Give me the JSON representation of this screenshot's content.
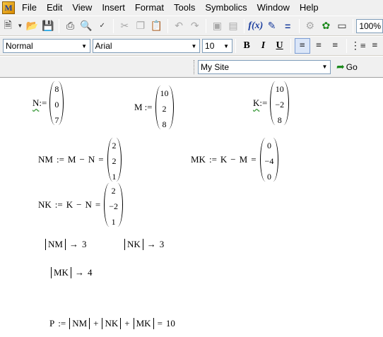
{
  "menubar": {
    "app_icon_label": "M",
    "items": [
      "File",
      "Edit",
      "View",
      "Insert",
      "Format",
      "Tools",
      "Symbolics",
      "Window",
      "Help"
    ]
  },
  "toolbar_standard": {
    "zoom": "100%",
    "icons": [
      "new-icon",
      "open-icon",
      "save-icon",
      "print-icon",
      "print-preview-icon",
      "spell-check-icon",
      "cut-icon",
      "copy-icon",
      "paste-icon",
      "undo-icon",
      "redo-icon",
      "align-across-icon",
      "align-down-icon",
      "insert-function-icon",
      "insert-unit-icon",
      "calculate-icon",
      "component-icon",
      "resource-icon",
      "zoom-icon"
    ]
  },
  "toolbar_format": {
    "style": "Normal",
    "font": "Arial",
    "size": "10",
    "bold": "B",
    "italic": "I",
    "underline": "U"
  },
  "toolbar_resources": {
    "site": "My Site",
    "go_label": "Go"
  },
  "worksheet": {
    "N": {
      "name": "N",
      "assign": ":=",
      "values": [
        "8",
        "0",
        "7"
      ]
    },
    "M": {
      "name": "M",
      "assign": ":=",
      "values": [
        "10",
        "2",
        "8"
      ]
    },
    "K": {
      "name": "K",
      "assign": ":=",
      "values": [
        "10",
        "−2",
        "8"
      ]
    },
    "NM": {
      "lhs": "NM",
      "assign": ":=",
      "a": "M",
      "minus": "−",
      "b": "N",
      "eq": "=",
      "values": [
        "2",
        "2",
        "1"
      ]
    },
    "MK": {
      "lhs": "MK",
      "assign": ":=",
      "a": "K",
      "minus": "−",
      "b": "M",
      "eq": "=",
      "values": [
        "0",
        "−4",
        "0"
      ]
    },
    "NK": {
      "lhs": "NK",
      "assign": ":=",
      "a": "K",
      "minus": "−",
      "b": "N",
      "eq": "=",
      "values": [
        "2",
        "−2",
        "1"
      ]
    },
    "abs_NM": {
      "name": "NM",
      "arrow": "→",
      "result": "3"
    },
    "abs_NK": {
      "name": "NK",
      "arrow": "→",
      "result": "3"
    },
    "abs_MK": {
      "name": "MK",
      "arrow": "→",
      "result": "4"
    },
    "P": {
      "name": "P",
      "assign": ":=",
      "t1": "NM",
      "t2": "NK",
      "t3": "MK",
      "plus": "+",
      "eq": "=",
      "result": "10"
    }
  }
}
